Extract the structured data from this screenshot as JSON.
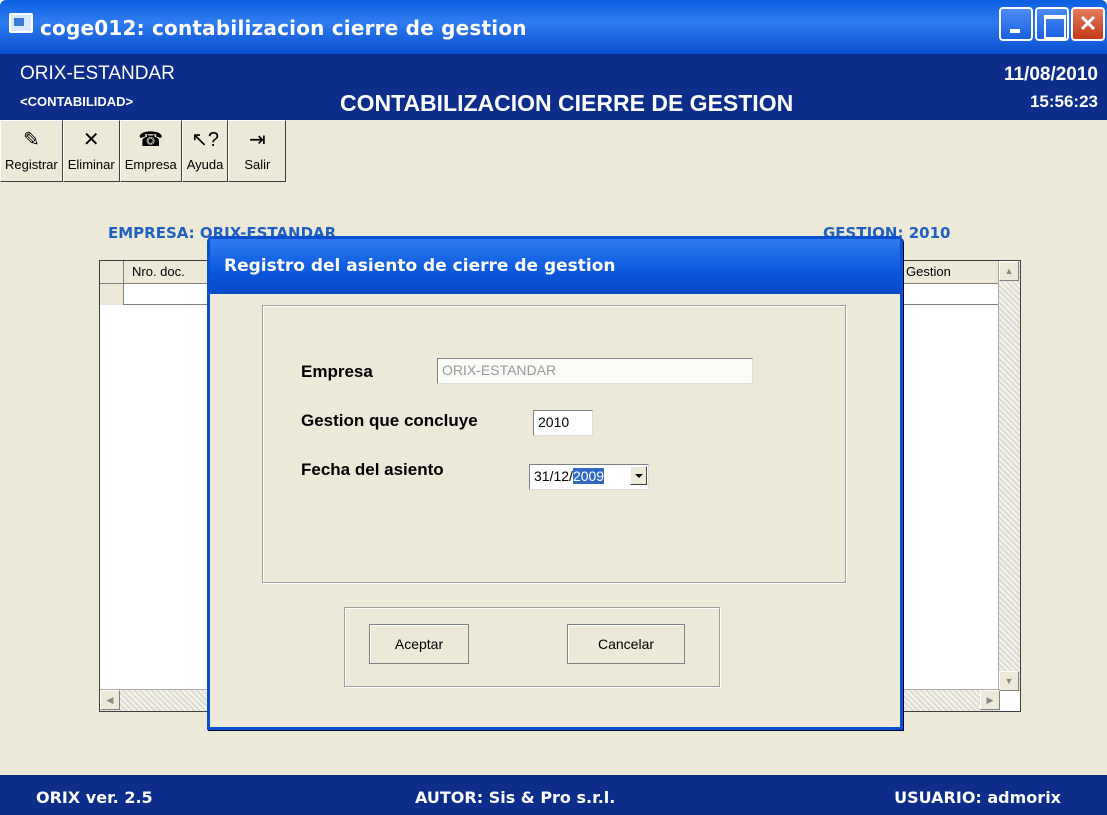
{
  "window": {
    "title": "coge012: contabilizacion cierre de gestion"
  },
  "header": {
    "org": "ORIX-ESTANDAR",
    "module": "<CONTABILIDAD>",
    "title": "CONTABILIZACION CIERRE DE GESTION",
    "date": "11/08/2010",
    "time": "15:56:23"
  },
  "toolbar": [
    {
      "label": "Registrar",
      "icon": "register-icon"
    },
    {
      "label": "Eliminar",
      "icon": "delete-icon"
    },
    {
      "label": "Empresa",
      "icon": "company-icon"
    },
    {
      "label": "Ayuda",
      "icon": "help-icon"
    },
    {
      "label": "Salir",
      "icon": "exit-icon"
    }
  ],
  "labels": {
    "empresa": "EMPRESA: ORIX-ESTANDAR",
    "gestion": "GESTION: 2010"
  },
  "grid": {
    "columns": [
      "Nro. doc.",
      "Gestion"
    ]
  },
  "dialog": {
    "title": "Registro del asiento de cierre de gestion",
    "empresa_label": "Empresa",
    "empresa_value": "ORIX-ESTANDAR",
    "gestion_label": "Gestion que concluye",
    "gestion_value": "2010",
    "fecha_label": "Fecha del asiento",
    "fecha_prefix": "31/12/",
    "fecha_year_selected": "2009",
    "accept": "Aceptar",
    "cancel": "Cancelar"
  },
  "status": {
    "version": "ORIX ver. 2.5",
    "author": "AUTOR: Sis & Pro s.r.l.",
    "user": "USUARIO: admorix"
  },
  "colors": {
    "header_bg": "#0c2d8a",
    "titlebar": "#0a5fe0",
    "accent_text": "#2060c0",
    "window_bg": "#ece9d8"
  }
}
